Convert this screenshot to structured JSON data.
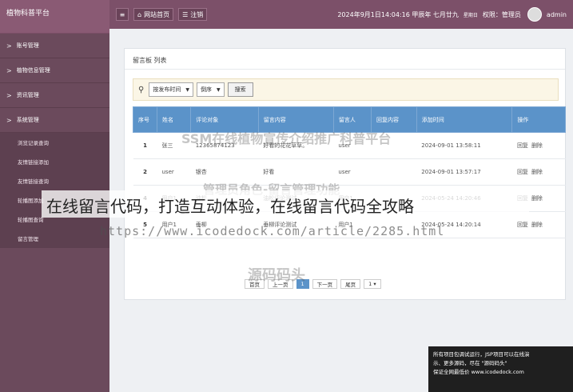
{
  "brand": "植物科普平台",
  "nav": [
    {
      "label": "账号管理",
      "chev": ">"
    },
    {
      "label": "植物信息管理",
      "chev": ">"
    },
    {
      "label": "资讯管理",
      "chev": ">"
    },
    {
      "label": "系统管理",
      "chev": ">"
    }
  ],
  "subnav": [
    "浏览记录查询",
    "友情链接添加",
    "友情链接查询",
    "轮播图添加",
    "轮播图查询",
    "留言管理"
  ],
  "topbar": {
    "site_home": "网站首页",
    "logout": "注销",
    "datetime": "2024年9月1日14:04:16 甲辰年 七月廿九",
    "weekday": "星期日",
    "permission": "权限：管理员",
    "user": "admin"
  },
  "panel": {
    "title": "留言板 列表"
  },
  "search": {
    "sort_by": "按发布时间",
    "order": "倒序",
    "button": "搜索"
  },
  "table": {
    "headers": [
      "序号",
      "姓名",
      "评论对象",
      "留言内容",
      "留言人",
      "回复内容",
      "添加时间",
      "操作"
    ],
    "rows": [
      {
        "no": "1",
        "name": "张三",
        "object": "12365874123",
        "content": "好看的花花草草。",
        "author": "user",
        "reply": "",
        "time": "2024-09-01 13:58:11",
        "ops": [
          "回复",
          "删除"
        ]
      },
      {
        "no": "2",
        "name": "user",
        "object": "银杏",
        "content": "好看",
        "author": "user",
        "reply": "",
        "time": "2024-09-01 13:57:17",
        "ops": [
          "回复",
          "删除"
        ]
      },
      {
        "no": "4",
        "name": "用户1",
        "object": "油松",
        "content": "油松评论测试",
        "author": "用户1",
        "reply": "",
        "time": "2024-05-24 14:20:46",
        "ops": [
          "回复",
          "删除"
        ]
      },
      {
        "no": "5",
        "name": "用户1",
        "object": "垂柳",
        "content": "垂柳评论测试",
        "author": "用户1",
        "reply": "",
        "time": "2024-05-24 14:20:14",
        "ops": [
          "回复",
          "删除"
        ]
      }
    ]
  },
  "pager": {
    "first": "首页",
    "prev": "上一页",
    "current": "1",
    "next": "下一页",
    "last": "尾页",
    "select": "1"
  },
  "overlay": {
    "wm1": "SSM在线植物宣传介绍推广科普平台",
    "wm2": "管理员角色-留言管理功能",
    "wm3": "源码码头",
    "caption": "在线留言代码，打造互动体验，在线留言代码全攻略",
    "url": "https://www.icodedock.com/article/2285.html",
    "promo1": "所有项目包调试运行，JSP项目可以在线演",
    "promo2": "示、更多源码，尽在 \"源码码头\"",
    "promo3": "保证全网最低价 www.icodedock.com"
  }
}
